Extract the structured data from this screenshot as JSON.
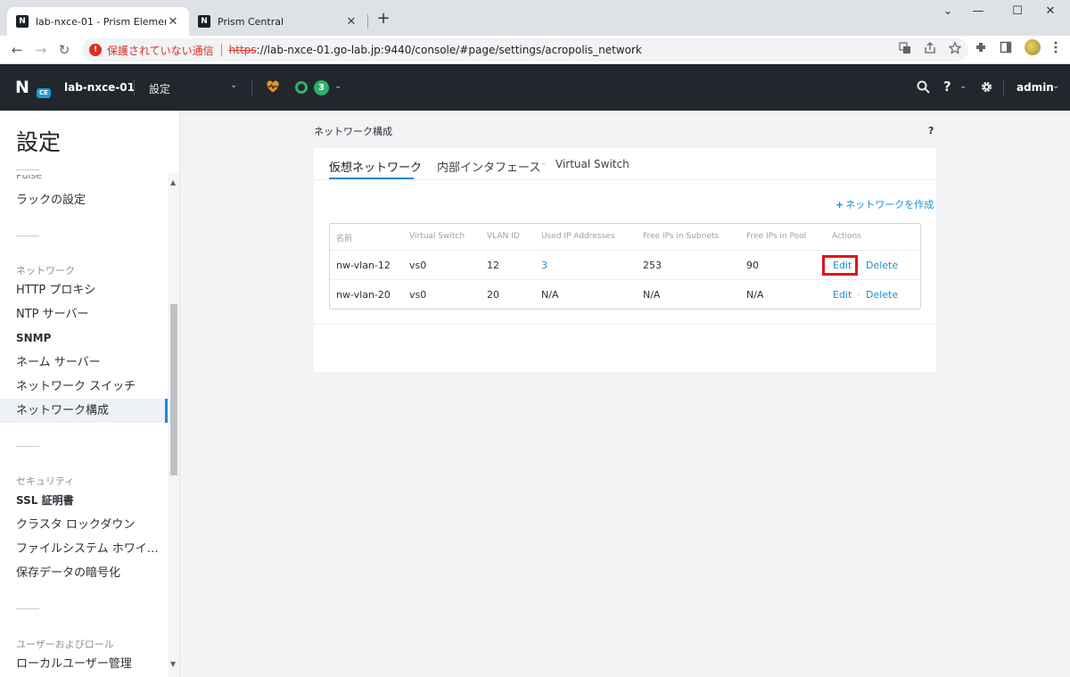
{
  "browser": {
    "tabs": [
      {
        "title": "lab-nxce-01 - Prism Element",
        "favicon": "N",
        "close": "✕"
      },
      {
        "title": "Prism Central",
        "favicon": "N",
        "close": "✕"
      }
    ],
    "new_tab": "+",
    "window_controls": {
      "tab_list": "⌄",
      "minimize": "—",
      "maximize": "☐",
      "close": "✕"
    },
    "nav": {
      "back": "←",
      "forward": "→",
      "reload": "↻"
    },
    "security": {
      "icon": "!",
      "label": "保護されていない通信"
    },
    "url": {
      "scheme": "https",
      "rest": "://lab-nxce-01.go-lab.jp:9440/console/#page/settings/acropolis_network"
    },
    "omnibox_icons": [
      "translate-icon",
      "share-icon",
      "star-icon"
    ],
    "toolbar_icons": [
      "extensions-icon",
      "sidepanel-icon",
      "profile-avatar",
      "menu-icon"
    ]
  },
  "header": {
    "logo_letter": "N",
    "logo_badge": "CE",
    "cluster_name": "lab-nxce-01",
    "page_name": "設定",
    "alert_count": "3",
    "user": "admin",
    "icons": {
      "search": "🔍",
      "help": "?",
      "gear": "⚙"
    },
    "colors": {
      "background": "#22272e",
      "health": "#e8941e",
      "alert": "#31b06f"
    }
  },
  "sidebar": {
    "title": "設定",
    "cut_item": "Pulse",
    "items": {
      "rack": "ラックの設定",
      "network_section": "ネットワーク",
      "http_proxy": "HTTP プロキシ",
      "ntp": "NTP サーバー",
      "snmp": "SNMP",
      "name_server": "ネーム サーバー",
      "network_switch": "ネットワーク スイッチ",
      "network_config": "ネットワーク構成",
      "security_section": "セキュリティ",
      "ssl": "SSL 証明書",
      "lockdown": "クラスタ ロックダウン",
      "fs_whitelist": "ファイルシステム ホワイト...",
      "encryption": "保存データの暗号化",
      "user_role_section": "ユーザーおよびロール",
      "local_user": "ローカルユーザー管理"
    }
  },
  "main": {
    "heading": "ネットワーク構成",
    "help": "?",
    "tabs": [
      {
        "label": "仮想ネットワーク",
        "active": true
      },
      {
        "label": "内部インタフェース",
        "active": false
      },
      {
        "label": "Virtual Switch",
        "active": false
      }
    ],
    "create_plus": "+",
    "create_label": "ネットワークを作成",
    "table": {
      "columns": [
        "名前",
        "Virtual Switch",
        "VLAN ID",
        "Used IP Addresses",
        "Free IPs in Subnets",
        "Free IPs in Pool",
        "Actions"
      ],
      "rows": [
        {
          "name": "nw-vlan-12",
          "vswitch": "vs0",
          "vlan": "12",
          "used_ip": "3",
          "free_subnet": "253",
          "free_pool": "90",
          "edit": "Edit",
          "sep": "·",
          "delete": "Delete"
        },
        {
          "name": "nw-vlan-20",
          "vswitch": "vs0",
          "vlan": "20",
          "used_ip": "N/A",
          "free_subnet": "N/A",
          "free_pool": "N/A",
          "edit": "Edit",
          "sep": "·",
          "delete": "Delete"
        }
      ]
    },
    "colors": {
      "accent": "#1b8cd8",
      "highlight": "#e0121c"
    }
  }
}
